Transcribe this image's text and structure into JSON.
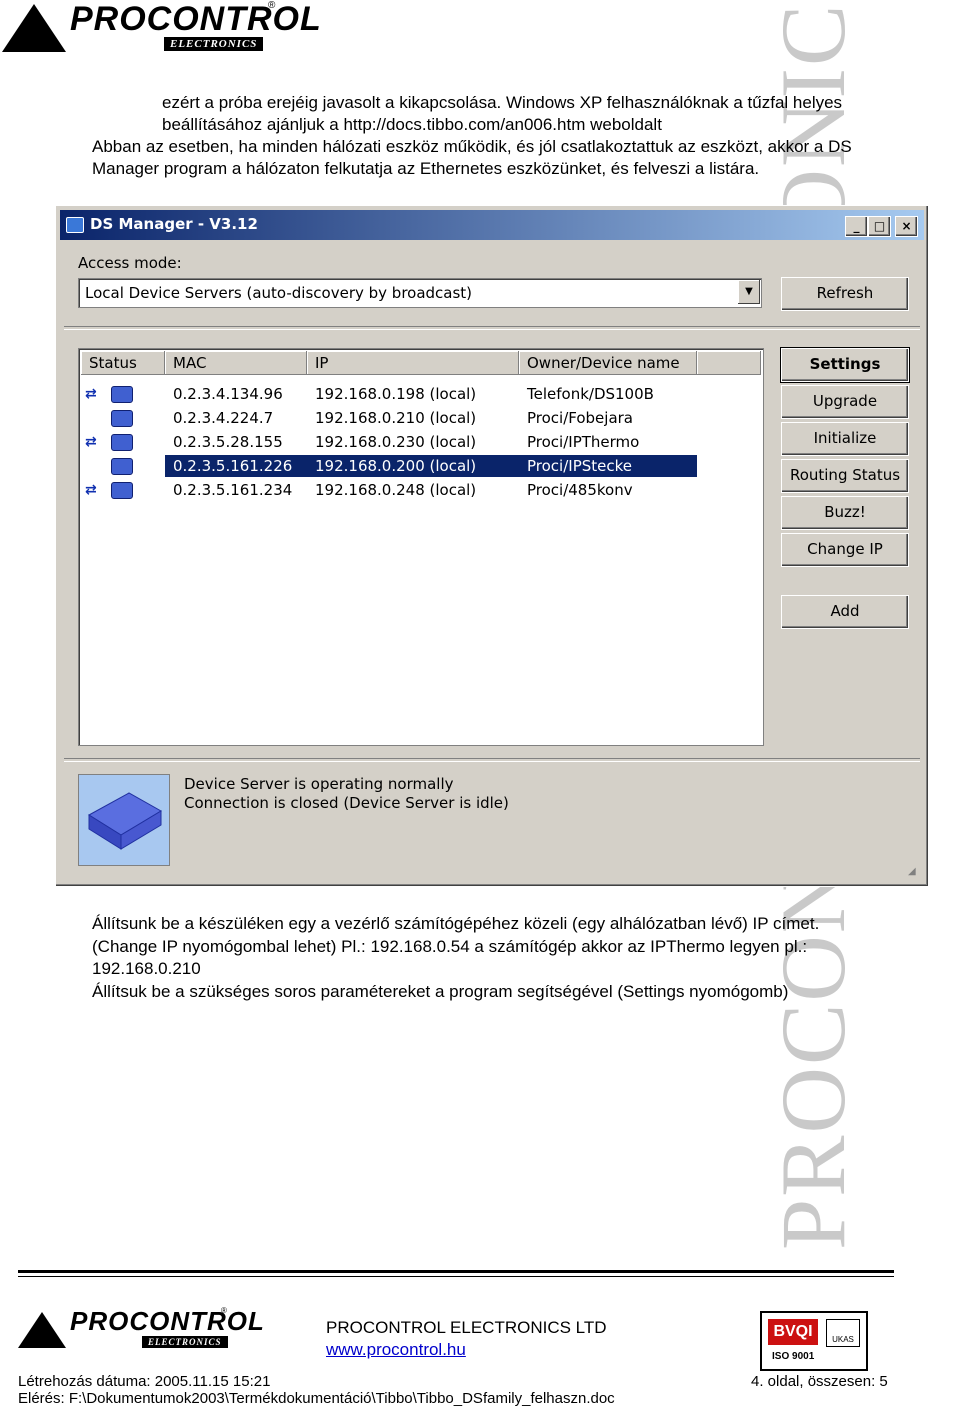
{
  "header": {
    "logo_word": "PROCONTROL",
    "logo_sub": "ELECTRONICS",
    "registered": "®"
  },
  "intro": {
    "lines": [
      "ezért a próba erejéig javasolt a kikapcsolása. Windows XP felhasználóknak a tűzfal helyes",
      "beállításához ajánljuk a http://docs.tibbo.com/an006.htm weboldalt",
      "Abban az esetben, ha minden hálózati eszköz működik, és jól csatlakoztattuk az eszközt, akkor a DS",
      "Manager program a hálózaton felkutatja az Ethernetes eszközünket, és felveszi a listára."
    ]
  },
  "dialog": {
    "title": "DS Manager - V3.12",
    "controls": {
      "minimize": "_",
      "maximize": "□",
      "close": "×"
    },
    "access_mode_label": "Access mode:",
    "access_mode_value": "Local Device Servers (auto-discovery by broadcast)",
    "refresh_label": "Refresh",
    "columns": [
      "Status",
      "MAC",
      "IP",
      "Owner/Device name"
    ],
    "rows": [
      {
        "status": "arrows+device",
        "mac": "0.2.3.4.134.96",
        "ip": "192.168.0.198 (local)",
        "owner": "Telefonk/DS100B"
      },
      {
        "status": "device",
        "mac": "0.2.3.4.224.7",
        "ip": "192.168.0.210 (local)",
        "owner": "Proci/Fobejara"
      },
      {
        "status": "arrows+device",
        "mac": "0.2.3.5.28.155",
        "ip": "192.168.0.230 (local)",
        "owner": "Proci/IPThermo"
      },
      {
        "status": "device",
        "mac": "0.2.3.5.161.226",
        "ip": "192.168.0.200 (local)",
        "owner": "Proci/IPStecke"
      },
      {
        "status": "arrows+device",
        "mac": "0.2.3.5.161.234",
        "ip": "192.168.0.248 (local)",
        "owner": "Proci/485konv"
      }
    ],
    "selected_row": 3,
    "buttons": {
      "settings": "Settings",
      "upgrade": "Upgrade",
      "initialize": "Initialize",
      "routing_status": "Routing Status",
      "buzz": "Buzz!",
      "change_ip": "Change IP",
      "add": "Add"
    },
    "status_line1": "Device Server is operating normally",
    "status_line2": "Connection is closed (Device Server is idle)"
  },
  "instructions": {
    "lines": [
      "Állítsunk be a készüléken egy a vezérlő számítógépéhez közeli (egy alhálózatban lévő) IP címet.",
      "(Change IP nyomógombal lehet) Pl.: 192.168.0.54 a számítógép akkor az IPThermo legyen pl.:",
      "192.168.0.210",
      "Állítsuk be a szükséges soros paramétereket a program segítségével (Settings nyomógomb)"
    ]
  },
  "watermark": "PROCONTROL ELECTRONICS LTD.",
  "footer": {
    "company": "PROCONTROL ELECTRONICS LTD",
    "website": "www.procontrol.hu",
    "created": "Létrehozás dátuma: 2005.11.15 15:21",
    "page": "4. oldal, összesen: 5",
    "path": "Elérés: F:\\Dokumentumok2003\\Termékdokumentáció\\Tibbo\\Tibbo_DSfamily_felhaszn.doc",
    "iso": "ISO 9001",
    "ukas": "UKAS",
    "bvqi": "BVQI"
  }
}
